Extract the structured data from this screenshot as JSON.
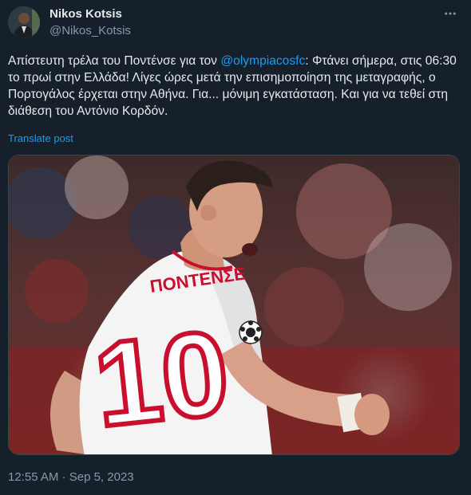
{
  "author": {
    "display_name": "Nikos Kotsis",
    "handle": "@Nikos_Kotsis"
  },
  "icons": {
    "more": "more-horizontal-icon"
  },
  "tweet": {
    "text_before_mention": "Απίστευτη τρέλα του Ποντένσε για τον ",
    "mention": "@olympiacosfc",
    "text_after_mention": ": Φτάνει σήμερα, στις 06:30 το πρωί στην Ελλάδα! Λίγες ώρες μετά την επισημοποίηση της μεταγραφής, ο Πορτογάλος έρχεται στην Αθήνα. Για... μόνιμη εγκατάσταση. Και για να τεθεί στη διάθεση του Αντόνιο Κορδόν.",
    "translate_label": "Translate post"
  },
  "media": {
    "jersey_name": "ΠΟΝΤΕΝΣΕ",
    "jersey_number": "10"
  },
  "meta": {
    "time": "12:55 AM",
    "separator": " · ",
    "date": "Sep 5, 2023"
  },
  "colors": {
    "background": "#15202b",
    "text_primary": "#e7e9ea",
    "text_secondary": "#8b98a5",
    "link": "#1d9bf0",
    "jersey_red": "#c8102e"
  }
}
